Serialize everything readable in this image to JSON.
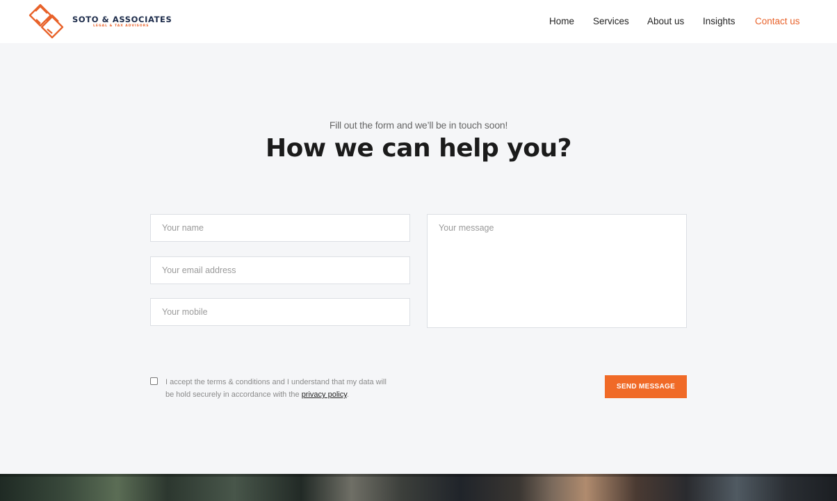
{
  "brand": {
    "name": "SOTO & ASSOCIATES",
    "tagline": "LEGAL & TAX ADVISORS",
    "accent_color": "#e8622a",
    "text_color": "#1c2b4a"
  },
  "nav": {
    "items": [
      {
        "label": "Home",
        "active": false
      },
      {
        "label": "Services",
        "active": false
      },
      {
        "label": "About us",
        "active": false
      },
      {
        "label": "Insights",
        "active": false
      },
      {
        "label": "Contact us",
        "active": true
      }
    ]
  },
  "hero": {
    "subtitle": "Fill out the form and we’ll be in touch soon!",
    "title": "How we can help you?"
  },
  "form": {
    "name_placeholder": "Your name",
    "email_placeholder": "Your email address",
    "mobile_placeholder": "Your mobile",
    "message_placeholder": "Your message",
    "terms_text": "I accept the terms & conditions and I understand that my data will be hold securely in accordance with the",
    "privacy_link": "privacy policy",
    "terms_end": ".",
    "submit_label": "SEND MESSAGE",
    "submit_color": "#f06a27"
  }
}
